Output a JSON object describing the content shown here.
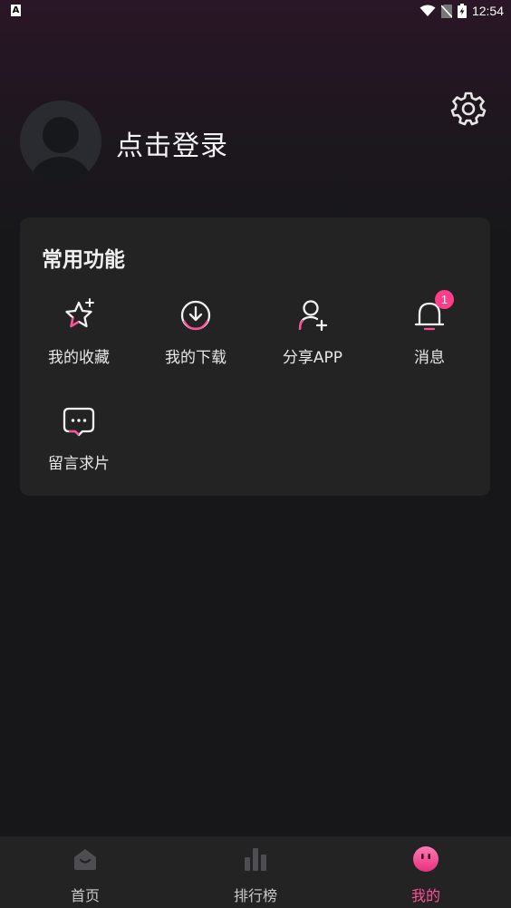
{
  "status_bar": {
    "time": "12:54",
    "left_icon": "A"
  },
  "header": {
    "login_text": "点击登录",
    "settings_icon": "gear-icon",
    "avatar_icon": "default-avatar"
  },
  "features": {
    "title": "常用功能",
    "items": [
      {
        "label": "我的收藏",
        "icon": "star-sparkle-icon"
      },
      {
        "label": "我的下载",
        "icon": "download-icon"
      },
      {
        "label": "分享APP",
        "icon": "add-user-icon"
      },
      {
        "label": "消息",
        "icon": "bell-icon",
        "badge": "1"
      },
      {
        "label": "留言求片",
        "icon": "chat-bubble-icon"
      }
    ]
  },
  "bottom_nav": {
    "items": [
      {
        "label": "首页",
        "icon": "home-icon",
        "active": false
      },
      {
        "label": "排行榜",
        "icon": "bar-chart-icon",
        "active": false
      },
      {
        "label": "我的",
        "icon": "smiley-icon",
        "active": true
      }
    ]
  },
  "colors": {
    "accent": "#ff4f97",
    "badge": "#ff3e8a",
    "card": "#232324",
    "background": "#17171a"
  }
}
